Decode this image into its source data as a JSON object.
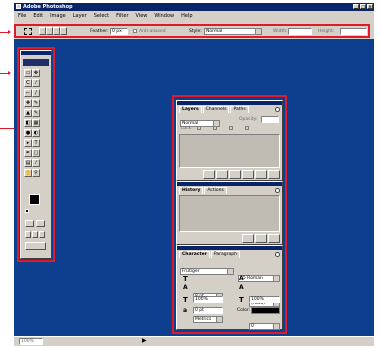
{
  "window": {
    "title": "Adobe Photoshop"
  },
  "menu": [
    "File",
    "Edit",
    "Image",
    "Layer",
    "Select",
    "Filter",
    "View",
    "Window",
    "Help"
  ],
  "options": {
    "feather_label": "Feather:",
    "feather_value": "0 px",
    "antialiased_label": "Anti-aliased",
    "style_label": "Style:",
    "style_value": "Normal",
    "width_label": "Width:",
    "height_label": "Height:"
  },
  "layers_palette": {
    "tabs": [
      "Layers",
      "Channels",
      "Paths"
    ],
    "blend_mode": "Normal",
    "opacity_label": "Opacity:",
    "lock_label": "Lock:"
  },
  "history_palette": {
    "tabs": [
      "History",
      "Actions"
    ]
  },
  "character_palette": {
    "tabs": [
      "Character",
      "Paragraph"
    ],
    "font_family": "Frutiger",
    "font_style": "55 Roman",
    "size": "8 pt",
    "leading": "(Auto)",
    "kerning": "Metrics",
    "tracking": "0",
    "vertical_scale": "100%",
    "horizontal_scale": "100%",
    "baseline_shift": "0 pt",
    "color_label": "Color:"
  },
  "status": {
    "zoom": "100%"
  },
  "colors": {
    "annotation": "#e0192b",
    "workspace": "#0e3f8e",
    "titlebar": "#0a246a",
    "chrome": "#d4d0c8"
  }
}
